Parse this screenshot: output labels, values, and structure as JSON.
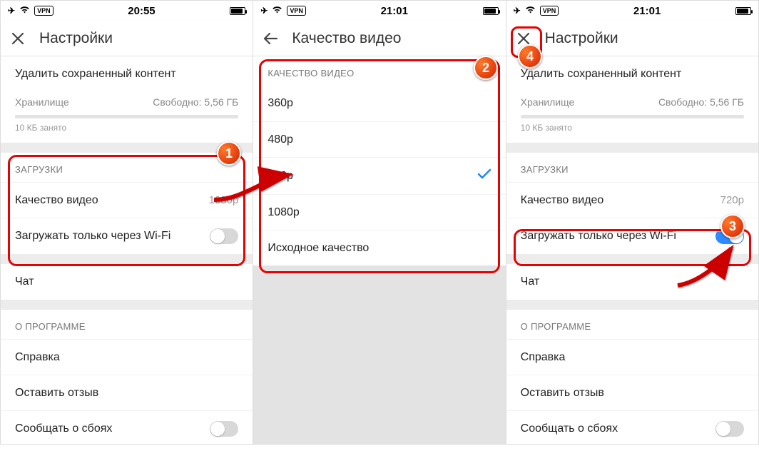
{
  "screens": [
    {
      "statusbar": {
        "time": "20:55",
        "vpn": "VPN"
      },
      "header": {
        "title": "Настройки",
        "icon": "close"
      },
      "delete_saved": "Удалить сохраненный контент",
      "storage": {
        "label": "Хранилище",
        "free": "Свободно: 5,56 ГБ",
        "used": "10 КБ занято"
      },
      "downloads": {
        "section": "ЗАГРУЗКИ",
        "quality_label": "Качество видео",
        "quality_value": "1080p",
        "wifi_label": "Загружать только через Wi-Fi",
        "wifi_on": false
      },
      "chat": "Чат",
      "about": {
        "section": "О ПРОГРАММЕ",
        "help": "Справка",
        "feedback": "Оставить отзыв",
        "crash": "Сообщать о сбоях"
      }
    },
    {
      "statusbar": {
        "time": "21:01",
        "vpn": "VPN"
      },
      "header": {
        "title": "Качество видео",
        "icon": "back"
      },
      "quality": {
        "section": "КАЧЕСТВО ВИДЕО",
        "options": [
          "360p",
          "480p",
          "720p",
          "1080p",
          "Исходное качество"
        ],
        "selected": "720p"
      }
    },
    {
      "statusbar": {
        "time": "21:01",
        "vpn": "VPN"
      },
      "header": {
        "title": "Настройки",
        "icon": "close"
      },
      "delete_saved": "Удалить сохраненный контент",
      "storage": {
        "label": "Хранилище",
        "free": "Свободно: 5,56 ГБ",
        "used": "10 КБ занято"
      },
      "downloads": {
        "section": "ЗАГРУЗКИ",
        "quality_label": "Качество видео",
        "quality_value": "720p",
        "wifi_label": "Загружать только через Wi-Fi",
        "wifi_on": true
      },
      "chat": "Чат",
      "about": {
        "section": "О ПРОГРАММЕ",
        "help": "Справка",
        "feedback": "Оставить отзыв",
        "crash": "Сообщать о сбоях"
      }
    }
  ],
  "badges": {
    "b1": "1",
    "b2": "2",
    "b3": "3",
    "b4": "4"
  }
}
